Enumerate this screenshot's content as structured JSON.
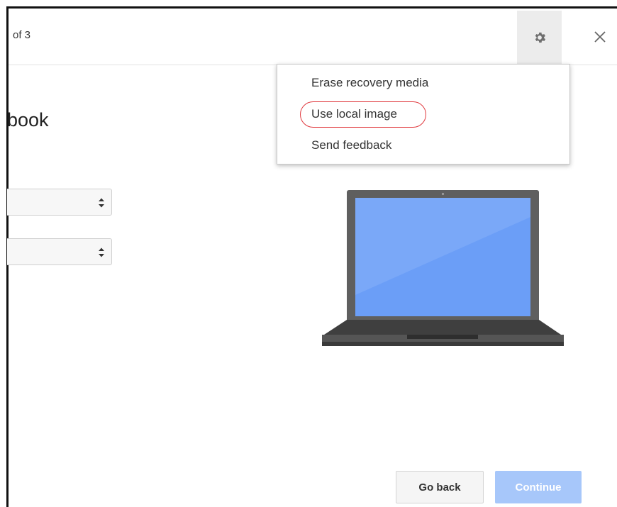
{
  "header": {
    "step_text": "of 3"
  },
  "page": {
    "title_partial": "book"
  },
  "menu": {
    "items": [
      {
        "label": "Erase recovery media"
      },
      {
        "label": "Use local image",
        "highlighted": true
      },
      {
        "label": "Send feedback"
      }
    ]
  },
  "buttons": {
    "back_label": "Go back",
    "continue_label": "Continue"
  },
  "icons": {
    "settings": "gear-icon",
    "close": "close-icon",
    "select_arrows": "updown-arrows-icon",
    "illustration": "chromebook-laptop-illustration"
  },
  "colors": {
    "highlight_ring": "#e0393e",
    "continue_button": "#a7c7fa",
    "laptop_screen": "#6b9ef7",
    "laptop_body": "#5f5f5f"
  }
}
